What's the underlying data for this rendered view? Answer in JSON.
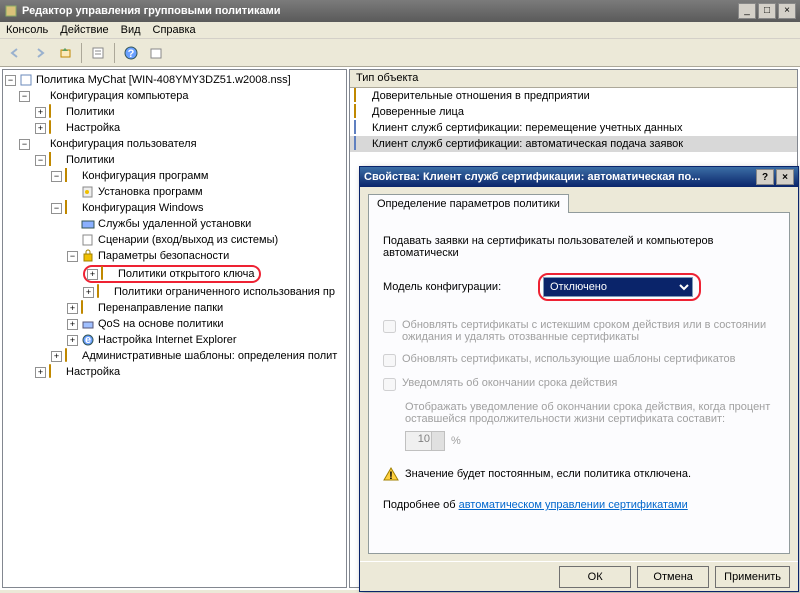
{
  "window": {
    "title": "Редактор управления групповыми политиками"
  },
  "menus": {
    "console": "Консоль",
    "action": "Действие",
    "view": "Вид",
    "help": "Справка"
  },
  "tree": {
    "root": "Политика MyChat [WIN-408YMY3DZ51.w2008.nss]",
    "comp_config": "Конфигурация компьютера",
    "comp_policies": "Политики",
    "comp_settings": "Настройка",
    "user_config": "Конфигурация пользователя",
    "user_policies": "Политики",
    "soft_config": "Конфигурация программ",
    "soft_install": "Установка программ",
    "win_config": "Конфигурация Windows",
    "remote_svc": "Службы удаленной установки",
    "scenarios": "Сценарии (вход/выход из системы)",
    "sec_params": "Параметры безопасности",
    "pubkey_policies": "Политики открытого ключа",
    "restricted_policies": "Политики ограниченного использования пр",
    "folder_redirect": "Перенаправление папки",
    "qos": "QoS на основе политики",
    "ie_settings": "Настройка Internet Explorer",
    "admin_templates": "Административные шаблоны: определения полит",
    "user_settings": "Настройка"
  },
  "right": {
    "header": "Тип объекта",
    "items": [
      "Доверительные отношения в предприятии",
      "Доверенные лица",
      "Клиент служб сертификации: перемещение учетных данных",
      "Клиент служб сертификации: автоматическая подача заявок"
    ]
  },
  "dialog": {
    "title": "Свойства: Клиент служб сертификации: автоматическая по...",
    "tab": "Определение параметров политики",
    "desc": "Подавать заявки на сертификаты пользователей и компьютеров автоматически",
    "config_label": "Модель конфигурации:",
    "config_value": "Отключено",
    "chk1": "Обновлять сертификаты с истекшим сроком действия или в состоянии  ожидания и удалять отозванные сертификаты",
    "chk2": "Обновлять сертификаты, использующие шаблоны сертификатов",
    "chk3": "Уведомлять об окончании срока действия",
    "notify_desc": "Отображать уведомление об окончании срока действия, когда процент оставшейся продолжительности жизни сертификата составит:",
    "pct_value": "10",
    "pct_unit": "%",
    "warning": "Значение будет постоянным, если политика отключена.",
    "more_pre": "Подробнее об ",
    "more_link": "автоматическом управлении сертификатами",
    "ok": "ОК",
    "cancel": "Отмена",
    "apply": "Применить"
  }
}
